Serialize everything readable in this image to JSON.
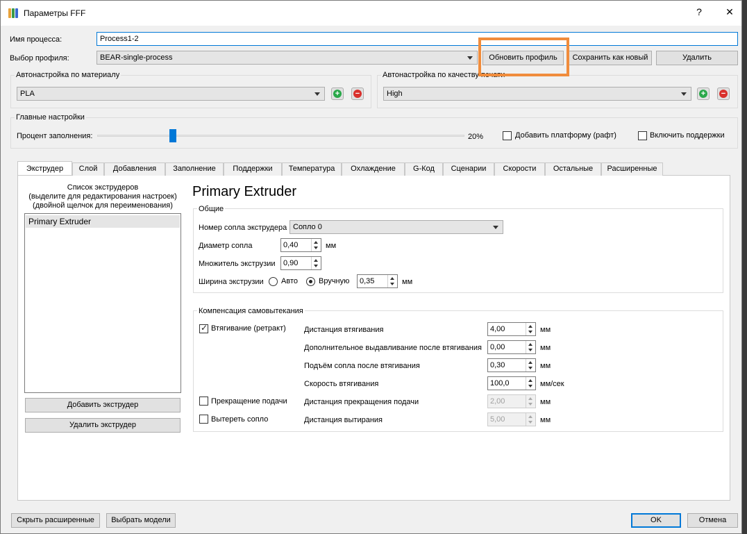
{
  "window": {
    "title": "Параметры FFF",
    "help_label": "?",
    "close_label": "✕"
  },
  "process": {
    "name_label": "Имя процесса:",
    "name_value": "Process1-2",
    "profile_label": "Выбор профиля:",
    "profile_value": "BEAR-single-process",
    "update_button": "Обновить профиль",
    "save_new_button": "Сохранить как новый",
    "delete_button": "Удалить"
  },
  "auto_material": {
    "title": "Автонастройка по  материалу",
    "value": "PLA"
  },
  "auto_quality": {
    "title": "Автонастройка по качеству печати",
    "value": "High"
  },
  "main_settings": {
    "title": "Главные настройки",
    "infill_label": "Процент заполнения:",
    "infill_value_text": "20%",
    "infill_fraction": 0.2,
    "raft_label": "Добавить платформу (рафт)",
    "raft_checked": false,
    "support_label": "Включить поддержки",
    "support_checked": false
  },
  "tabs": [
    {
      "label": "Экструдер",
      "active": true
    },
    {
      "label": "Слой"
    },
    {
      "label": "Добавления"
    },
    {
      "label": "Заполнение"
    },
    {
      "label": "Поддержки"
    },
    {
      "label": "Температура"
    },
    {
      "label": "Охлаждение"
    },
    {
      "label": "G-Код"
    },
    {
      "label": "Сценарии"
    },
    {
      "label": "Скорости"
    },
    {
      "label": "Остальные"
    },
    {
      "label": "Расширенные"
    }
  ],
  "extruder_list": {
    "heading_line1": "Список экструдеров",
    "heading_line2": "(выделите для редактирования настроек)",
    "heading_line3": "(двойной щелчок для переименования)",
    "items": [
      "Primary Extruder"
    ],
    "add_button": "Добавить экструдер",
    "remove_button": "Удалить экструдер"
  },
  "extruder": {
    "title": "Primary Extruder",
    "general": {
      "title": "Общие",
      "nozzle_number_label": "Номер сопла экструдера",
      "nozzle_number_value": "Сопло 0",
      "nozzle_diameter_label": "Диаметр сопла",
      "nozzle_diameter_value": "0,40",
      "nozzle_diameter_unit": "мм",
      "extrusion_multiplier_label": "Множитель экструзии",
      "extrusion_multiplier_value": "0,90",
      "extrusion_width_label": "Ширина экструзии",
      "auto_label": "Авто",
      "auto_checked": false,
      "manual_label": "Вручную",
      "manual_checked": true,
      "extrusion_width_value": "0,35",
      "extrusion_width_unit": "мм"
    },
    "ooze": {
      "title": "Компенсация самовытекания",
      "retraction_label": "Втягивание (ретракт)",
      "retraction_checked": true,
      "retraction_distance_label": "Дистанция втягивания",
      "retraction_distance_value": "4,00",
      "retraction_distance_unit": "мм",
      "extra_restart_label": "Дополнительное выдавливание после втягивания",
      "extra_restart_value": "0,00",
      "extra_restart_unit": "мм",
      "lift_label": "Подъём сопла после втягивания",
      "lift_value": "0,30",
      "lift_unit": "мм",
      "retraction_speed_label": "Скорость втягивания",
      "retraction_speed_value": "100,0",
      "retraction_speed_unit": "мм/сек",
      "coast_label": "Прекращение подачи",
      "coast_checked": false,
      "coast_distance_label": "Дистанция прекращения подачи",
      "coast_distance_value": "2,00",
      "coast_distance_unit": "мм",
      "wipe_label": "Вытереть сопло",
      "wipe_checked": false,
      "wipe_distance_label": "Дистанция вытирания",
      "wipe_distance_value": "5,00",
      "wipe_distance_unit": "мм"
    }
  },
  "footer": {
    "hide_advanced": "Скрыть расширенные",
    "select_models": "Выбрать модели",
    "ok": "OK",
    "cancel": "Отмена"
  },
  "colors": {
    "accent": "#0078d7",
    "highlight": "#f08c3c"
  },
  "icons": {
    "app": "simplify3d-icon",
    "add": "plus-circle-icon",
    "remove": "minus-circle-icon",
    "dropdown": "chevron-down-icon"
  }
}
